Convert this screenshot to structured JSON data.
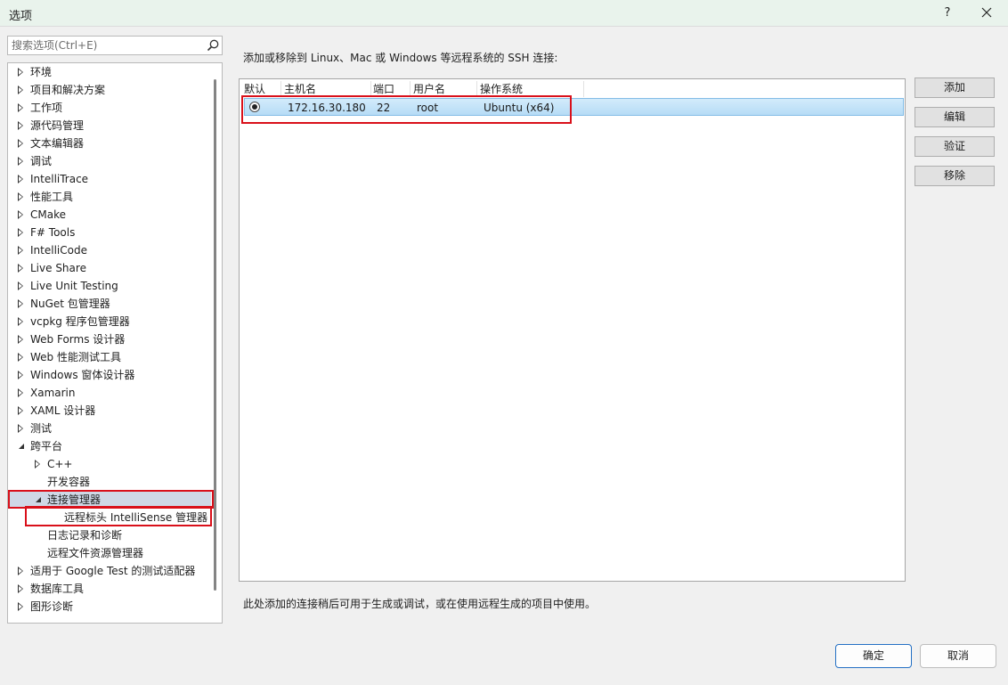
{
  "window": {
    "title": "选项",
    "help": "?"
  },
  "search": {
    "placeholder": "搜索选项(Ctrl+E)"
  },
  "tree": [
    {
      "label": "环境",
      "state": "closed",
      "level": 0
    },
    {
      "label": "项目和解决方案",
      "state": "closed",
      "level": 0
    },
    {
      "label": "工作项",
      "state": "closed",
      "level": 0
    },
    {
      "label": "源代码管理",
      "state": "closed",
      "level": 0
    },
    {
      "label": "文本编辑器",
      "state": "closed",
      "level": 0
    },
    {
      "label": "调试",
      "state": "closed",
      "level": 0
    },
    {
      "label": "IntelliTrace",
      "state": "closed",
      "level": 0
    },
    {
      "label": "性能工具",
      "state": "closed",
      "level": 0
    },
    {
      "label": "CMake",
      "state": "closed",
      "level": 0
    },
    {
      "label": "F# Tools",
      "state": "closed",
      "level": 0
    },
    {
      "label": "IntelliCode",
      "state": "closed",
      "level": 0
    },
    {
      "label": "Live Share",
      "state": "closed",
      "level": 0
    },
    {
      "label": "Live Unit Testing",
      "state": "closed",
      "level": 0
    },
    {
      "label": "NuGet 包管理器",
      "state": "closed",
      "level": 0
    },
    {
      "label": "vcpkg 程序包管理器",
      "state": "closed",
      "level": 0
    },
    {
      "label": "Web Forms 设计器",
      "state": "closed",
      "level": 0
    },
    {
      "label": "Web 性能测试工具",
      "state": "closed",
      "level": 0
    },
    {
      "label": "Windows 窗体设计器",
      "state": "closed",
      "level": 0
    },
    {
      "label": "Xamarin",
      "state": "closed",
      "level": 0
    },
    {
      "label": "XAML 设计器",
      "state": "closed",
      "level": 0
    },
    {
      "label": "测试",
      "state": "closed",
      "level": 0
    },
    {
      "label": "跨平台",
      "state": "open",
      "level": 0
    },
    {
      "label": "C++",
      "state": "closed",
      "level": 1
    },
    {
      "label": "开发容器",
      "state": "leaf",
      "level": 1
    },
    {
      "label": "连接管理器",
      "state": "open",
      "level": 1,
      "selected": true
    },
    {
      "label": "远程标头 IntelliSense 管理器",
      "state": "leaf",
      "level": 2
    },
    {
      "label": "日志记录和诊断",
      "state": "leaf",
      "level": 1
    },
    {
      "label": "远程文件资源管理器",
      "state": "leaf",
      "level": 1
    },
    {
      "label": "适用于 Google Test 的测试适配器",
      "state": "closed",
      "level": 0
    },
    {
      "label": "数据库工具",
      "state": "closed",
      "level": 0
    },
    {
      "label": "图形诊断",
      "state": "closed",
      "level": 0
    }
  ],
  "main": {
    "description": "添加或移除到 Linux、Mac 或 Windows 等远程系统的 SSH 连接:",
    "columns": [
      "默认",
      "主机名",
      "端口",
      "用户名",
      "操作系统"
    ],
    "rows": [
      {
        "host": "172.16.30.180",
        "port": "22",
        "user": "root",
        "os": "Ubuntu (x64)",
        "default": true
      }
    ],
    "note": "此处添加的连接稍后可用于生成或调试，或在使用远程生成的项目中使用。"
  },
  "side_buttons": {
    "add": "添加",
    "edit": "编辑",
    "verify": "验证",
    "remove": "移除"
  },
  "footer": {
    "ok": "确定",
    "cancel": "取消"
  },
  "colors": {
    "highlight_box": "#d9101a",
    "selected_row": "#cfe6f8",
    "tree_selection": "#cfd8e6",
    "primary_border": "#2470c4"
  }
}
